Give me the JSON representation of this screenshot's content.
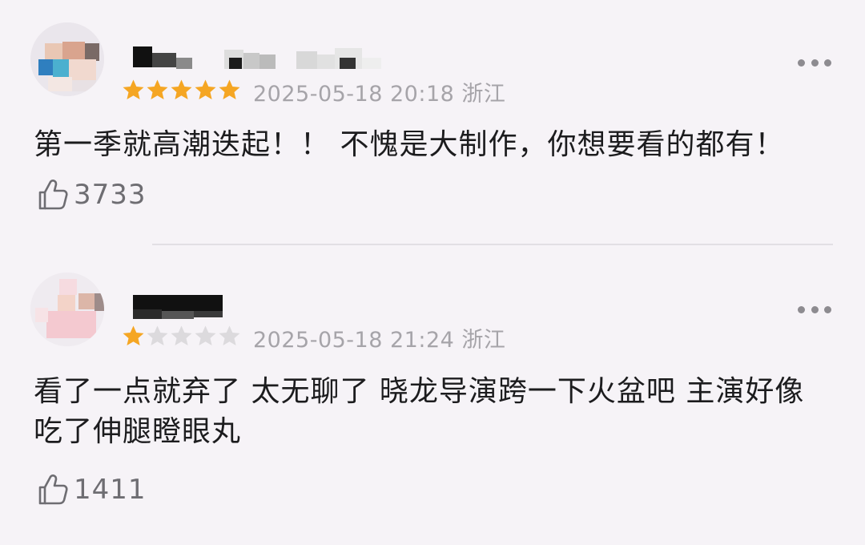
{
  "colors": {
    "background": "#f6f3f7",
    "star_filled": "#f5a623",
    "star_empty": "#dcdadd",
    "meta_text": "#a6a4a9",
    "body_text": "#1c1c1e"
  },
  "comments": [
    {
      "rating": 5,
      "rating_max": 5,
      "meta": "2025-05-18 20:18 浙江",
      "text": "第一季就高潮迭起！！ 不愧是大制作，你想要看的都有！",
      "likes": "3733",
      "avatar_icon": "avatar-icon",
      "like_icon": "thumbs-up-icon",
      "more_icon": "more-dots-icon"
    },
    {
      "rating": 1,
      "rating_max": 5,
      "meta": "2025-05-18 21:24 浙江",
      "text": "看了一点就弃了 太无聊了 晓龙导演跨一下火盆吧 主演好像吃了伸腿瞪眼丸",
      "likes": "1411",
      "avatar_icon": "avatar-icon",
      "like_icon": "thumbs-up-icon",
      "more_icon": "more-dots-icon"
    }
  ]
}
